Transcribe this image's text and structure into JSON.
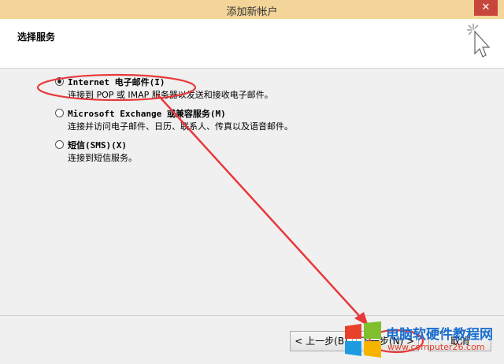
{
  "window": {
    "title": "添加新帐户",
    "close_label": "✕"
  },
  "header": {
    "title": "选择服务"
  },
  "options": [
    {
      "label": "Internet 电子邮件(I)",
      "description": "连接到 POP 或 IMAP 服务器以发送和接收电子邮件。",
      "selected": true
    },
    {
      "label": "Microsoft Exchange 或兼容服务(M)",
      "description": "连接并访问电子邮件、日历、联系人、传真以及语音邮件。",
      "selected": false
    },
    {
      "label": "短信(SMS)(X)",
      "description": "连接到短信服务。",
      "selected": false
    }
  ],
  "footer": {
    "back_label": "< 上一步(B)",
    "next_label": "下一步(N) >",
    "cancel_label": "取消"
  },
  "watermark": {
    "title": "电脑软硬件教程网",
    "url": "www.computer26.com"
  },
  "colors": {
    "titlebar": "#f3d59a",
    "annotation": "#e8383a",
    "brand_blue": "#1a6fd0"
  }
}
